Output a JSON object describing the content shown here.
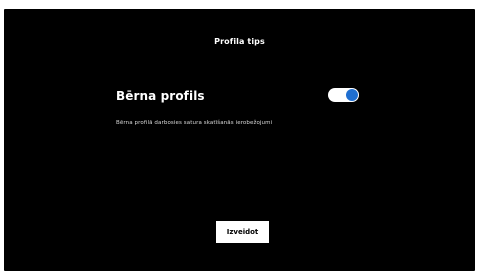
{
  "page": {
    "title": "Profila tips"
  },
  "setting": {
    "label": "Bērna profils",
    "description": "Bērna profilā darbosies satura skatīšanās ierobežojumi",
    "toggle_state": "on",
    "toggle_color": "#1f6fd1"
  },
  "actions": {
    "create_label": "Izveidot"
  }
}
